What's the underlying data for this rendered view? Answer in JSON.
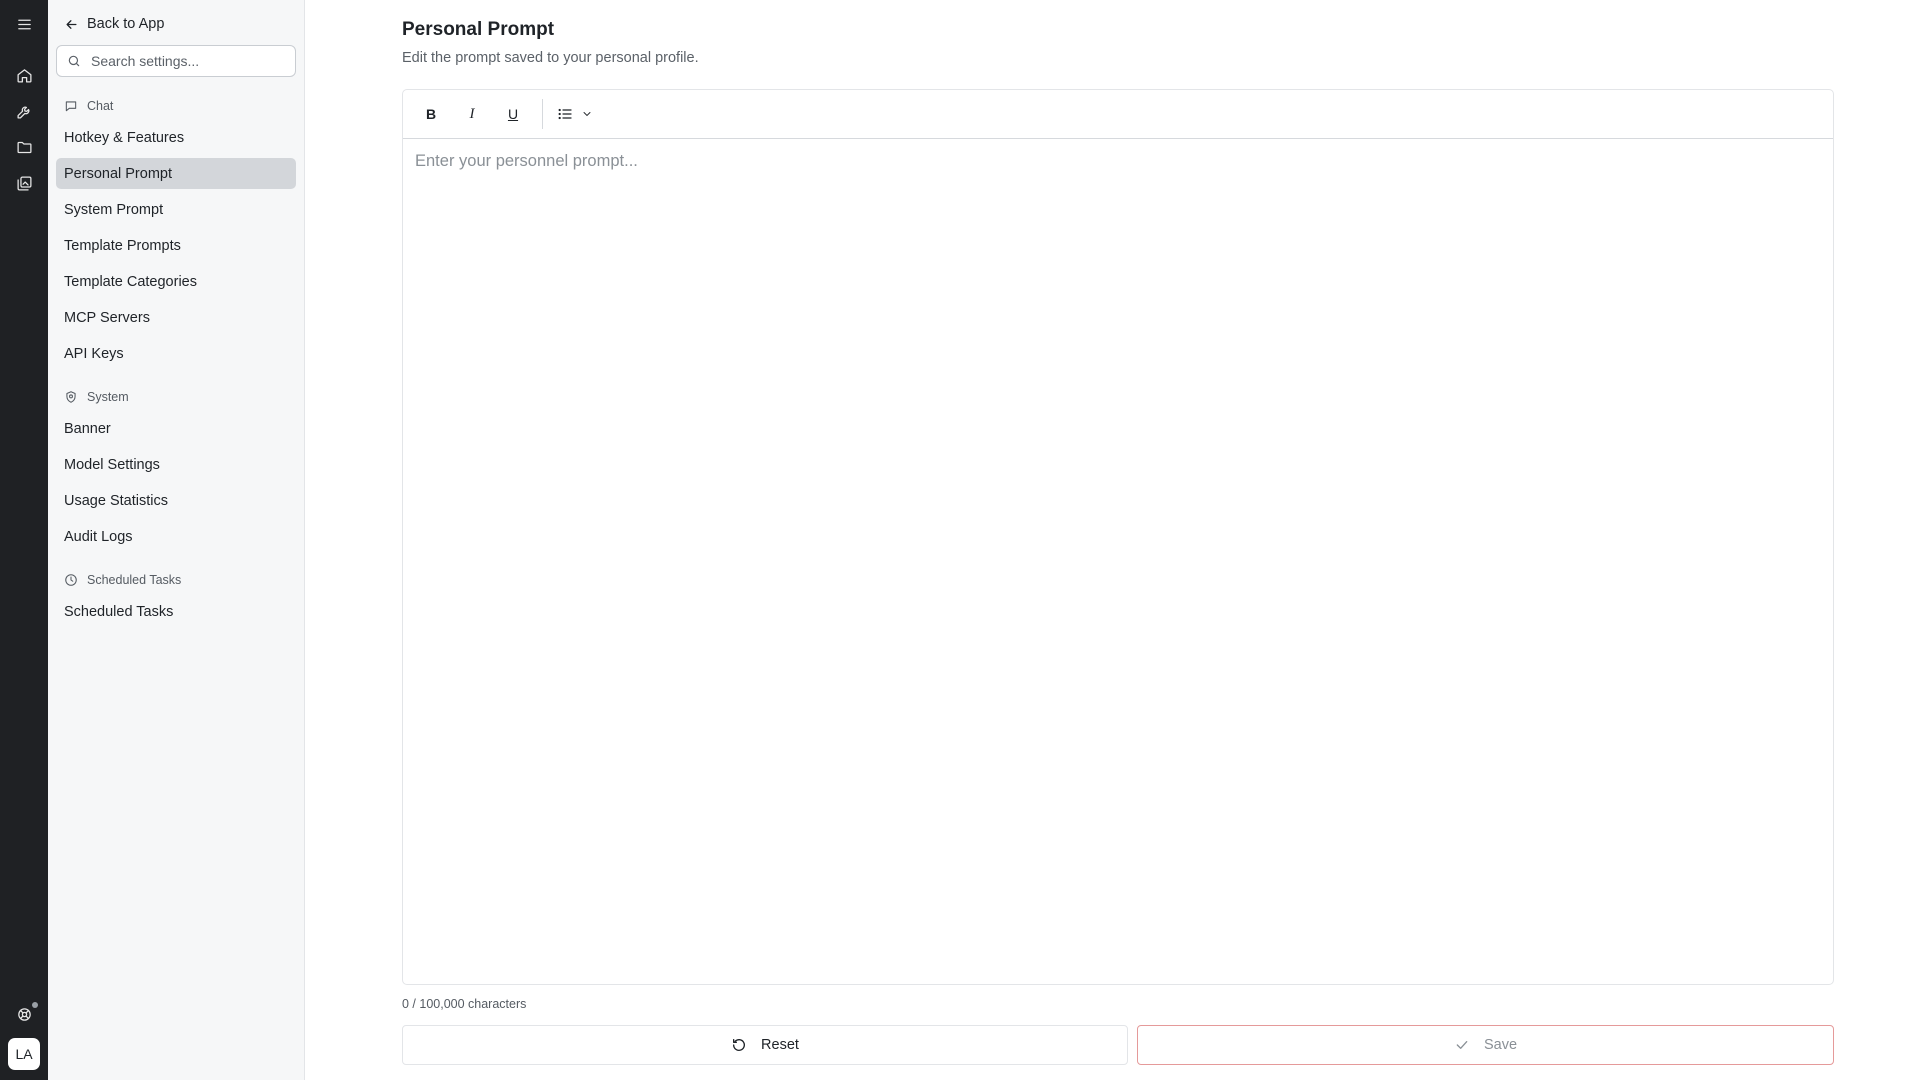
{
  "rail": {
    "icons": [
      "menu-icon",
      "home-icon",
      "tools-icon",
      "folder-icon",
      "gallery-icon",
      "help-icon"
    ],
    "avatar_initials": "LA"
  },
  "sidebar": {
    "back_label": "Back to App",
    "search_placeholder": "Search settings...",
    "sections": [
      {
        "title": "Chat",
        "icon": "chat-icon",
        "items": [
          "Hotkey & Features",
          "Personal Prompt",
          "System Prompt",
          "Template Prompts",
          "Template Categories",
          "MCP Servers",
          "API Keys"
        ]
      },
      {
        "title": "System",
        "icon": "shield-icon",
        "items": [
          "Banner",
          "Model Settings",
          "Usage Statistics",
          "Audit Logs"
        ]
      },
      {
        "title": "Scheduled Tasks",
        "icon": "clock-icon",
        "items": [
          "Scheduled Tasks"
        ]
      }
    ],
    "active_item": "Personal Prompt"
  },
  "main": {
    "title": "Personal Prompt",
    "subtitle": "Edit the prompt saved to your personal profile.",
    "toolbar": {
      "bold_label": "B",
      "italic_label": "I",
      "underline_label": "U"
    },
    "editor": {
      "value": "",
      "placeholder": "Enter your personnel prompt..."
    },
    "char_count": "0 / 100,000 characters",
    "reset_label": "Reset",
    "save_label": "Save"
  },
  "colors": {
    "rail_bg": "#1f2124",
    "sidebar_bg": "#f6f7f8",
    "active_item_bg": "#d3d6da",
    "save_border": "#e59a9a"
  }
}
